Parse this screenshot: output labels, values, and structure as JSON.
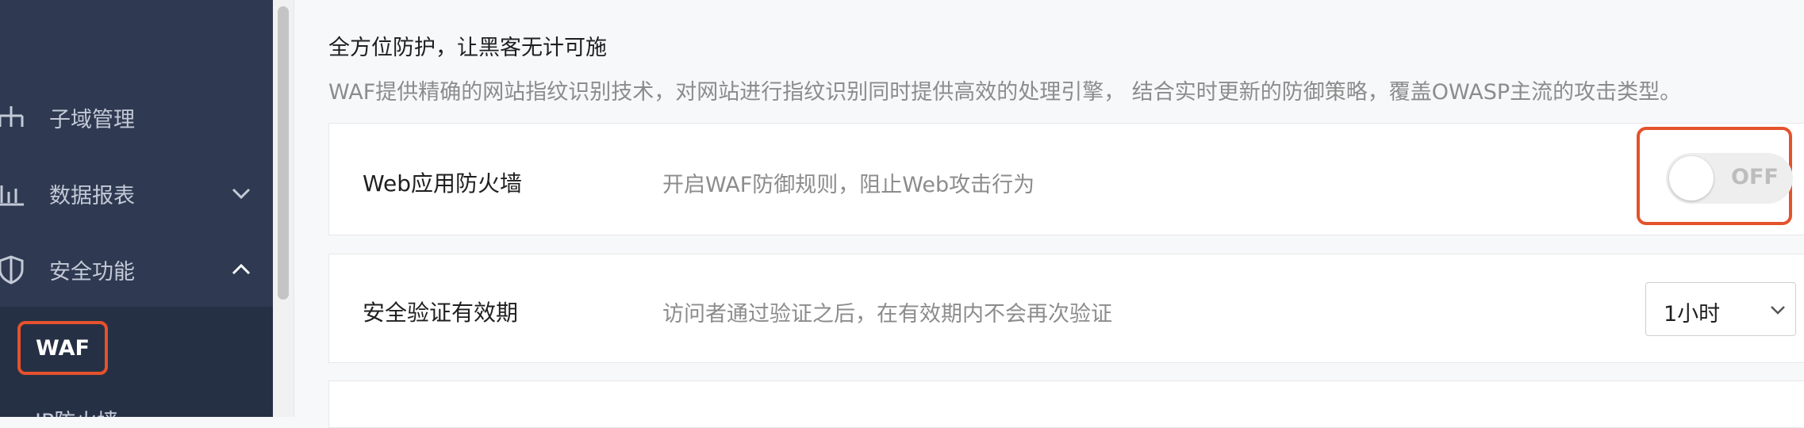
{
  "sidebar": {
    "items": [
      {
        "label": "子域管理",
        "icon": "sitemap-icon"
      },
      {
        "label": "数据报表",
        "icon": "bar-chart-icon",
        "expanded": false
      },
      {
        "label": "安全功能",
        "icon": "shield-icon",
        "expanded": true
      }
    ],
    "submenu": {
      "active": "WAF",
      "next": "IP防火墙"
    }
  },
  "main": {
    "heading": "全方位防护，让黑客无计可施",
    "description": "WAF提供精确的网站指纹识别技术，对网站进行指纹识别同时提供高效的处理引擎， 结合实时更新的防御策略，覆盖OWASP主流的攻击类型。",
    "settings": [
      {
        "title": "Web应用防火墙",
        "hint": "开启WAF防御规则，阻止Web攻击行为",
        "control": "toggle",
        "value": "OFF"
      },
      {
        "title": "安全验证有效期",
        "hint": "访问者通过验证之后，在有效期内不会再次验证",
        "control": "select",
        "value": "1小时"
      }
    ]
  },
  "colors": {
    "sidebar_bg": "#2f3a52",
    "highlight": "#e4522c"
  }
}
